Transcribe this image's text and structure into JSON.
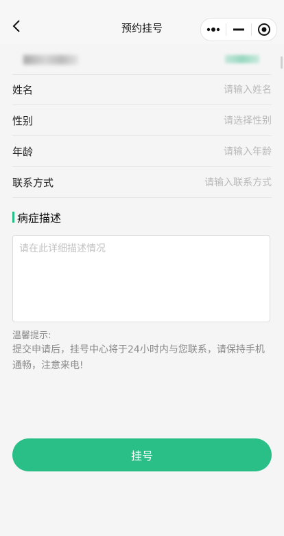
{
  "header": {
    "title": "预约挂号",
    "back_icon": "chevron-left-icon",
    "capsule": {
      "more_icon": "more-dots-icon",
      "minimize_icon": "minimize-icon",
      "close_icon": "target-icon"
    }
  },
  "form": {
    "fields": [
      {
        "label": "姓名",
        "placeholder": "请输入姓名"
      },
      {
        "label": "性别",
        "placeholder": "请选择性别"
      },
      {
        "label": "年龄",
        "placeholder": "请输入年龄"
      },
      {
        "label": "联系方式",
        "placeholder": "请输入联系方式"
      }
    ],
    "symptom": {
      "title": "病症描述",
      "placeholder": "请在此详细描述情况"
    },
    "tip": {
      "title": "温馨提示:",
      "text": "提交申请后，挂号中心将于24小时内与您联系，请保持手机通畅，注意来电!"
    },
    "submit_label": "挂号"
  },
  "colors": {
    "accent": "#2bbf88",
    "placeholder": "#b9b9b9",
    "background": "#f5f5f5"
  }
}
